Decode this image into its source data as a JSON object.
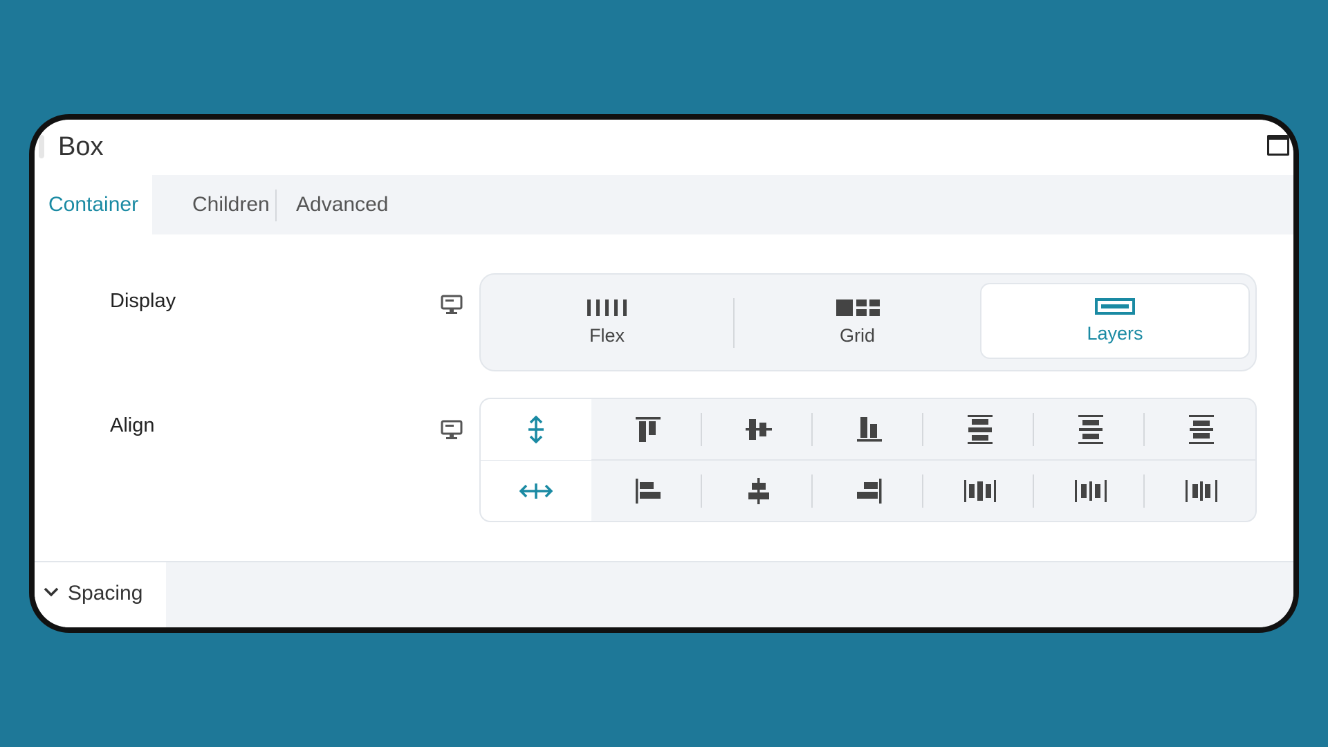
{
  "panel": {
    "title": "Box",
    "title_icon_right": "maximize-icon"
  },
  "tabs": [
    {
      "label": "Container",
      "active": true
    },
    {
      "label": "Children",
      "active": false
    },
    {
      "label": "Advanced",
      "active": false
    }
  ],
  "display": {
    "label": "Display",
    "device_icon": "desktop-icon",
    "options": [
      {
        "label": "Flex",
        "icon": "flex-columns-icon",
        "active": false
      },
      {
        "label": "Grid",
        "icon": "grid-icon",
        "active": false
      },
      {
        "label": "Layers",
        "icon": "layers-icon",
        "active": true
      }
    ]
  },
  "align": {
    "label": "Align",
    "device_icon": "desktop-icon",
    "vertical_row": [
      {
        "icon": "align-vertical-toggle-icon",
        "active": true
      },
      {
        "icon": "align-top-icon"
      },
      {
        "icon": "align-middle-icon"
      },
      {
        "icon": "align-bottom-icon"
      },
      {
        "icon": "space-between-vertical-icon"
      },
      {
        "icon": "space-around-vertical-icon"
      },
      {
        "icon": "space-evenly-vertical-icon"
      }
    ],
    "horizontal_row": [
      {
        "icon": "align-horizontal-toggle-icon",
        "active": true
      },
      {
        "icon": "align-left-icon"
      },
      {
        "icon": "align-center-icon"
      },
      {
        "icon": "align-right-icon"
      },
      {
        "icon": "space-between-horizontal-icon"
      },
      {
        "icon": "space-around-horizontal-icon"
      },
      {
        "icon": "space-evenly-horizontal-icon"
      }
    ]
  },
  "spacing": {
    "label": "Spacing",
    "expanded": false
  },
  "colors": {
    "accent": "#1a8aa3",
    "background": "#1e7898",
    "icon": "#444444"
  }
}
